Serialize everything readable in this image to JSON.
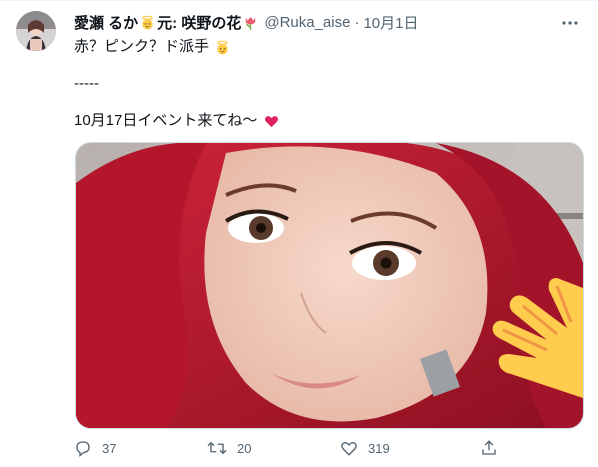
{
  "tweet": {
    "author": {
      "name_part1": "愛瀬 るか",
      "name_part2": "元: 咲野の花",
      "handle": "@Ruka_aise",
      "separator": "·",
      "time": "10月1日"
    },
    "text": {
      "line1": "赤？ピンク？ド派手",
      "line2": "-----",
      "line3": "10月17日イベント来てね〜"
    },
    "stats": {
      "replies": "37",
      "retweets": "20",
      "likes": "319"
    }
  },
  "colors": {
    "text_primary": "#0f1419",
    "text_secondary": "#536471",
    "heart_emoji": "#e0245e",
    "hair": "#b0182a",
    "wave_hand": "#ffcc4d"
  },
  "icons": [
    "avatar",
    "angel-emoji",
    "tulip-emoji",
    "more-icon",
    "heart-emoji",
    "reply-icon",
    "retweet-icon",
    "like-icon",
    "share-icon",
    "waving-hand-emoji"
  ]
}
